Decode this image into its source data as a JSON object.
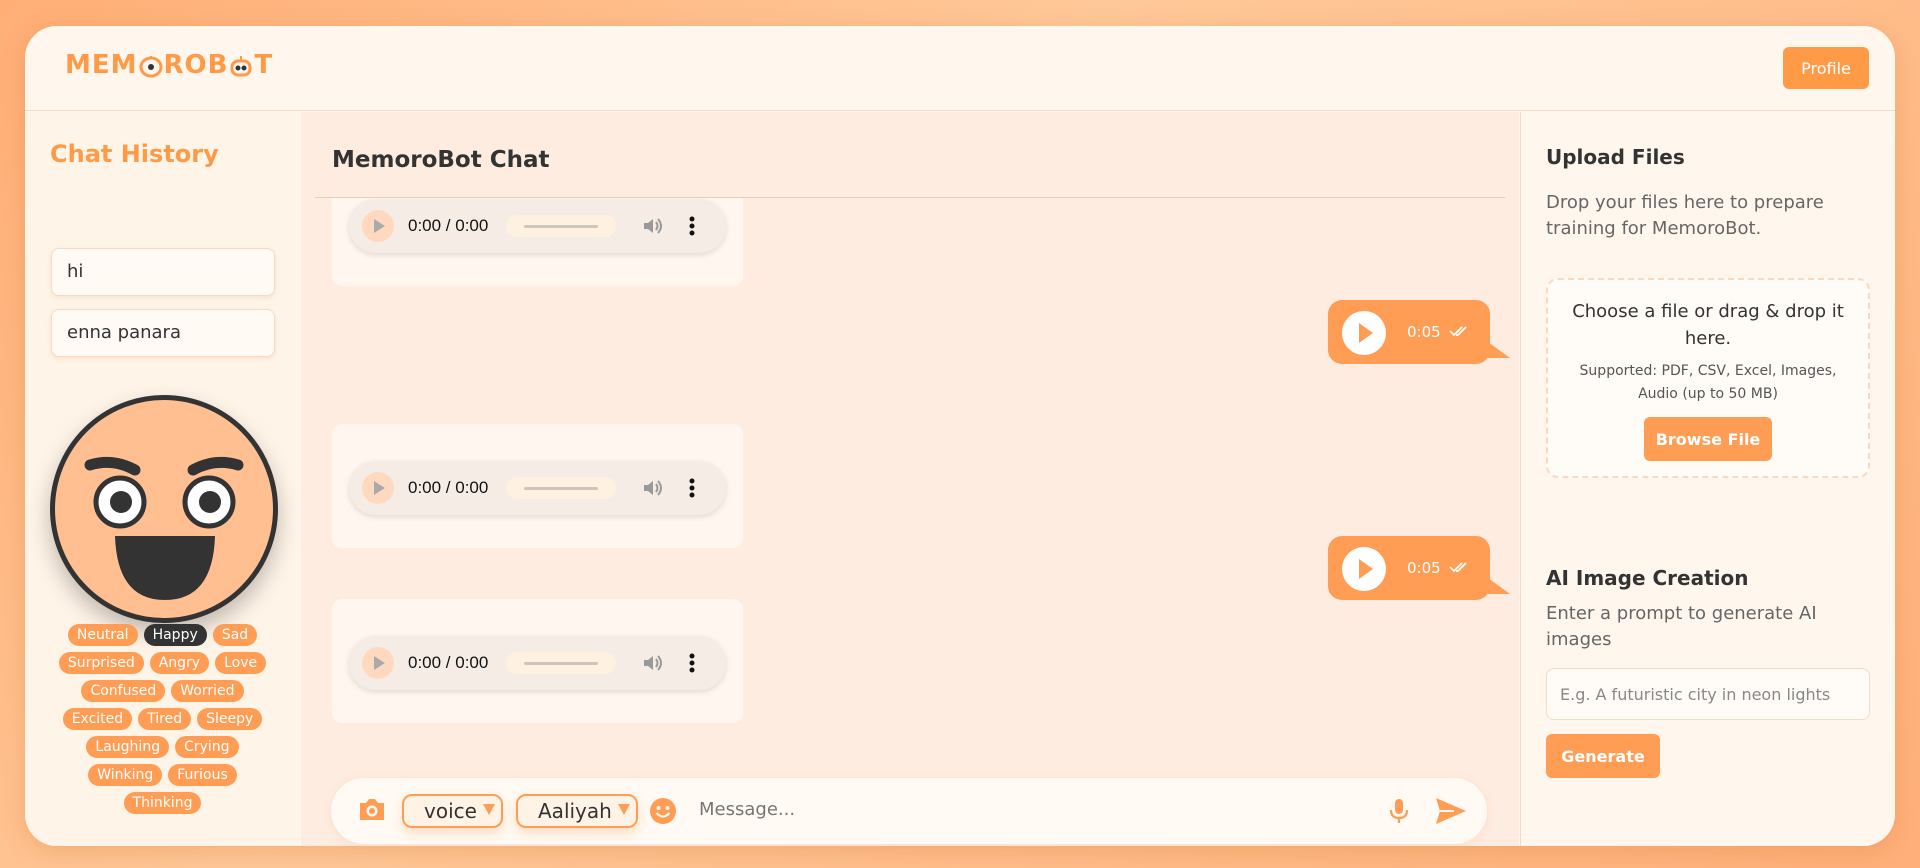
{
  "brand": {
    "logo_text_left": "MEM",
    "logo_text_mid": "RO",
    "logo_text_right": "B",
    "logo_text_end": "T",
    "accent": "#ff9d55",
    "dark": "#333333"
  },
  "header": {
    "profile_label": "Profile"
  },
  "sidebar": {
    "title": "Chat History",
    "items": [
      {
        "label": "hi"
      },
      {
        "label": "enna panara"
      }
    ],
    "avatar_expression": "happy-face",
    "emotions": [
      {
        "label": "Neutral"
      },
      {
        "label": "Happy",
        "active": true
      },
      {
        "label": "Sad"
      },
      {
        "label": "Surprised"
      },
      {
        "label": "Angry"
      },
      {
        "label": "Love"
      },
      {
        "label": "Confused"
      },
      {
        "label": "Worried"
      },
      {
        "label": "Excited"
      },
      {
        "label": "Tired"
      },
      {
        "label": "Sleepy"
      },
      {
        "label": "Laughing"
      },
      {
        "label": "Crying"
      },
      {
        "label": "Winking"
      },
      {
        "label": "Furious"
      },
      {
        "label": "Thinking"
      }
    ]
  },
  "chat": {
    "title": "MemoroBot Chat",
    "messages": [
      {
        "from": "bot",
        "type": "audio",
        "time": "0:00 / 0:00"
      },
      {
        "from": "user",
        "type": "voice",
        "duration": "0:05"
      },
      {
        "from": "bot",
        "type": "audio",
        "time": "0:00 / 0:00"
      },
      {
        "from": "user",
        "type": "voice",
        "duration": "0:05"
      },
      {
        "from": "bot",
        "type": "audio",
        "time": "0:00 / 0:00"
      }
    ],
    "input": {
      "mode_select": "voice",
      "voice_select": "Aaliyah",
      "placeholder": "Message..."
    }
  },
  "upload": {
    "title": "Upload Files",
    "description": "Drop your files here to prepare training for MemoroBot.",
    "drop_main": "Choose a file or drag & drop it here.",
    "drop_supported": "Supported: PDF, CSV, Excel, Images, Audio (up to 50 MB)",
    "browse_label": "Browse File"
  },
  "ai_image": {
    "title": "AI Image Creation",
    "description": "Enter a prompt to generate AI images",
    "placeholder": "E.g. A futuristic city in neon lights",
    "generate_label": "Generate"
  }
}
